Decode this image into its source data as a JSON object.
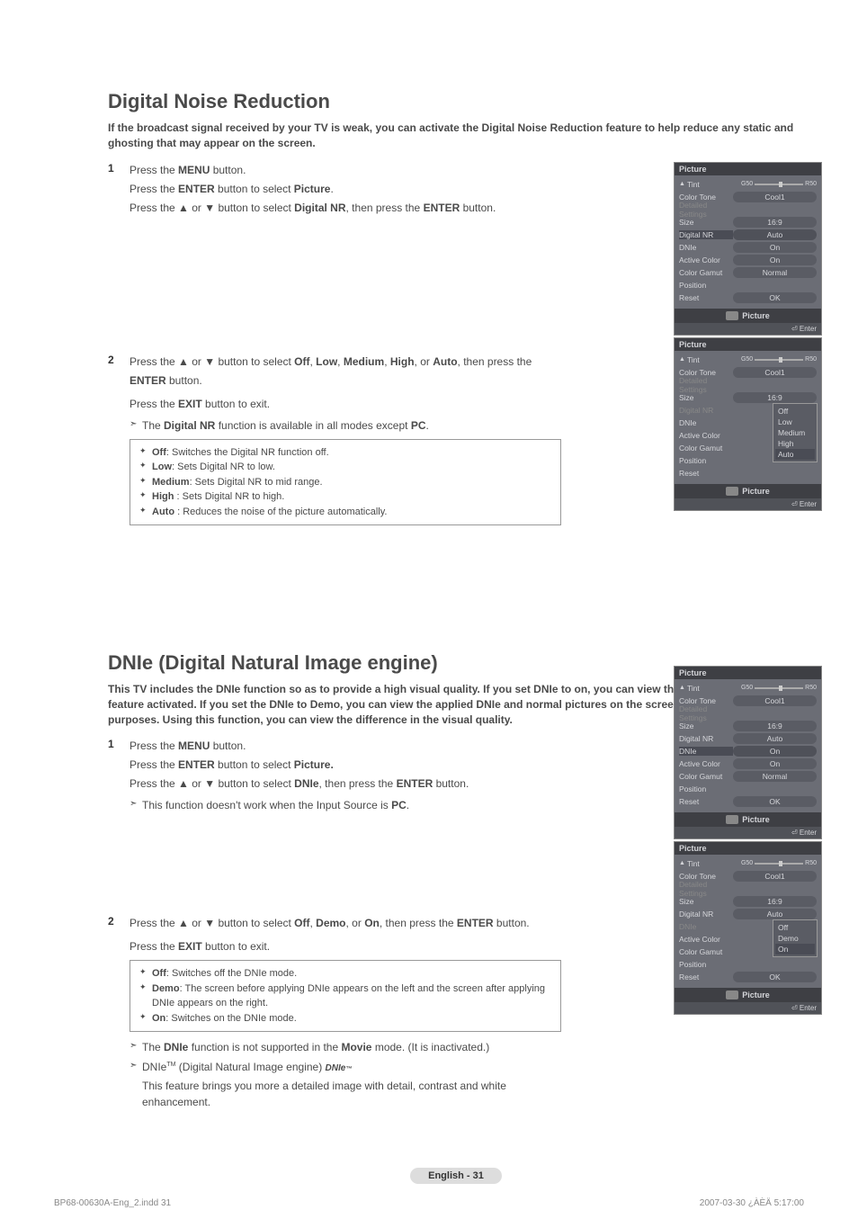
{
  "section1": {
    "title": "Digital Noise Reduction",
    "intro": "If the broadcast signal received by your TV is weak, you can activate the Digital Noise Reduction feature to help reduce any static and ghosting that may appear on the screen.",
    "step1_num": "1",
    "step1_l1a": "Press the ",
    "step1_l1b": "MENU",
    "step1_l1c": " button.",
    "step1_l2a": "Press the ",
    "step1_l2b": "ENTER",
    "step1_l2c": " button to select ",
    "step1_l2d": "Picture",
    "step1_l2e": ".",
    "step1_l3a": "Press the ▲ or ▼ button to select ",
    "step1_l3b": "Digital NR",
    "step1_l3c": ", then press the ",
    "step1_l3d": "ENTER",
    "step1_l3e": " button.",
    "step2_num": "2",
    "step2_l1a": "Press the ▲ or ▼ button to select ",
    "step2_l1b": "Off",
    "step2_l1c": ", ",
    "step2_l1d": "Low",
    "step2_l1e": ", ",
    "step2_l1f": "Medium",
    "step2_l1g": ", ",
    "step2_l1h": "High",
    "step2_l1i": ", or ",
    "step2_l1j": "Auto",
    "step2_l1k": ", then press the ",
    "step2_l2a": "ENTER",
    "step2_l2b": " button.",
    "step2_l3a": "Press the ",
    "step2_l3b": "EXIT",
    "step2_l3c": " button to exit.",
    "note1a": "The ",
    "note1b": "Digital NR",
    "note1c": " function is available in all modes except ",
    "note1d": "PC",
    "note1e": ".",
    "b1a": "Off",
    "b1b": ": Switches the Digital NR function off.",
    "b2a": "Low",
    "b2b": ": Sets Digital NR to low.",
    "b3a": "Medium",
    "b3b": ": Sets Digital NR to mid range.",
    "b4a": "High",
    "b4b": " : Sets Digital NR to high.",
    "b5a": "Auto",
    "b5b": " : Reduces the noise of the picture automatically."
  },
  "section2": {
    "title": "DNIe (Digital Natural Image engine)",
    "intro": "This TV includes the DNIe function so as to provide a high visual quality. If you set DNIe to on, you can view the screen with the DNIe feature activated. If you set the DNIe to Demo, you can view the applied DNIe and normal pictures on the screen, for demonstration purposes. Using this function, you can view the difference in the visual quality.",
    "step1_num": "1",
    "step1_l1a": "Press the ",
    "step1_l1b": "MENU",
    "step1_l1c": " button.",
    "step1_l2a": "Press the ",
    "step1_l2b": "ENTER",
    "step1_l2c": " button to select ",
    "step1_l2d": "Picture.",
    "step1_l3a": "Press the ▲ or ▼ button to select ",
    "step1_l3b": "DNIe",
    "step1_l3c": ", then press the ",
    "step1_l3d": "ENTER",
    "step1_l3e": " button.",
    "note0a": "This function doesn't work when the Input Source is ",
    "note0b": "PC",
    "note0c": ".",
    "step2_num": "2",
    "step2_l1a": "Press the ▲ or ▼ button to select ",
    "step2_l1b": "Off",
    "step2_l1c": ", ",
    "step2_l1d": "Demo",
    "step2_l1e": ", or ",
    "step2_l1f": "On",
    "step2_l1g": ", then press the ",
    "step2_l1h": "ENTER",
    "step2_l1i": " button.",
    "step2_l2a": "Press the ",
    "step2_l2b": "EXIT",
    "step2_l2c": " button to exit.",
    "b1a": "Off",
    "b1b": ": Switches off the DNIe mode.",
    "b2a": "Demo",
    "b2b": ": The screen before applying DNIe appears on the left and the screen after applying DNIe appears on the right.",
    "b3a": "On",
    "b3b": ": Switches on the DNIe mode.",
    "note1a": "The ",
    "note1b": "DNIe",
    "note1c": " function is not supported in the ",
    "note1d": "Movie",
    "note1e": " mode. (It is inactivated.)",
    "note2a": "DNIe",
    "note2b": "TM",
    "note2c": " (Digital Natural Image engine) ",
    "note2d": "DNIe",
    "note2e": "™",
    "note2f": "This feature brings you more a detailed image with detail, contrast and white enhancement."
  },
  "osd": {
    "title": "Picture",
    "tint": "Tint",
    "g50": "G50",
    "r50": "R50",
    "colortone": "Color Tone",
    "cool1": "Cool1",
    "detailed": "Detailed Settings",
    "size": "Size",
    "ratio169": "16:9",
    "digitalnr": "Digital NR",
    "auto": "Auto",
    "dnie": "DNIe",
    "on": "On",
    "activecolor": "Active Color",
    "colorgamut": "Color Gamut",
    "normal": "Normal",
    "position": "Position",
    "reset": "Reset",
    "ok": "OK",
    "enter": "Enter",
    "foottext": "Picture",
    "off": "Off",
    "low": "Low",
    "medium": "Medium",
    "high": "High",
    "demo": "Demo"
  },
  "footer": {
    "pagenum": "English - 31",
    "docfile": "BP68-00630A-Eng_2.indd   31",
    "timestamp": "2007-03-30   ¿ÀÈÄ 5:17:00"
  }
}
